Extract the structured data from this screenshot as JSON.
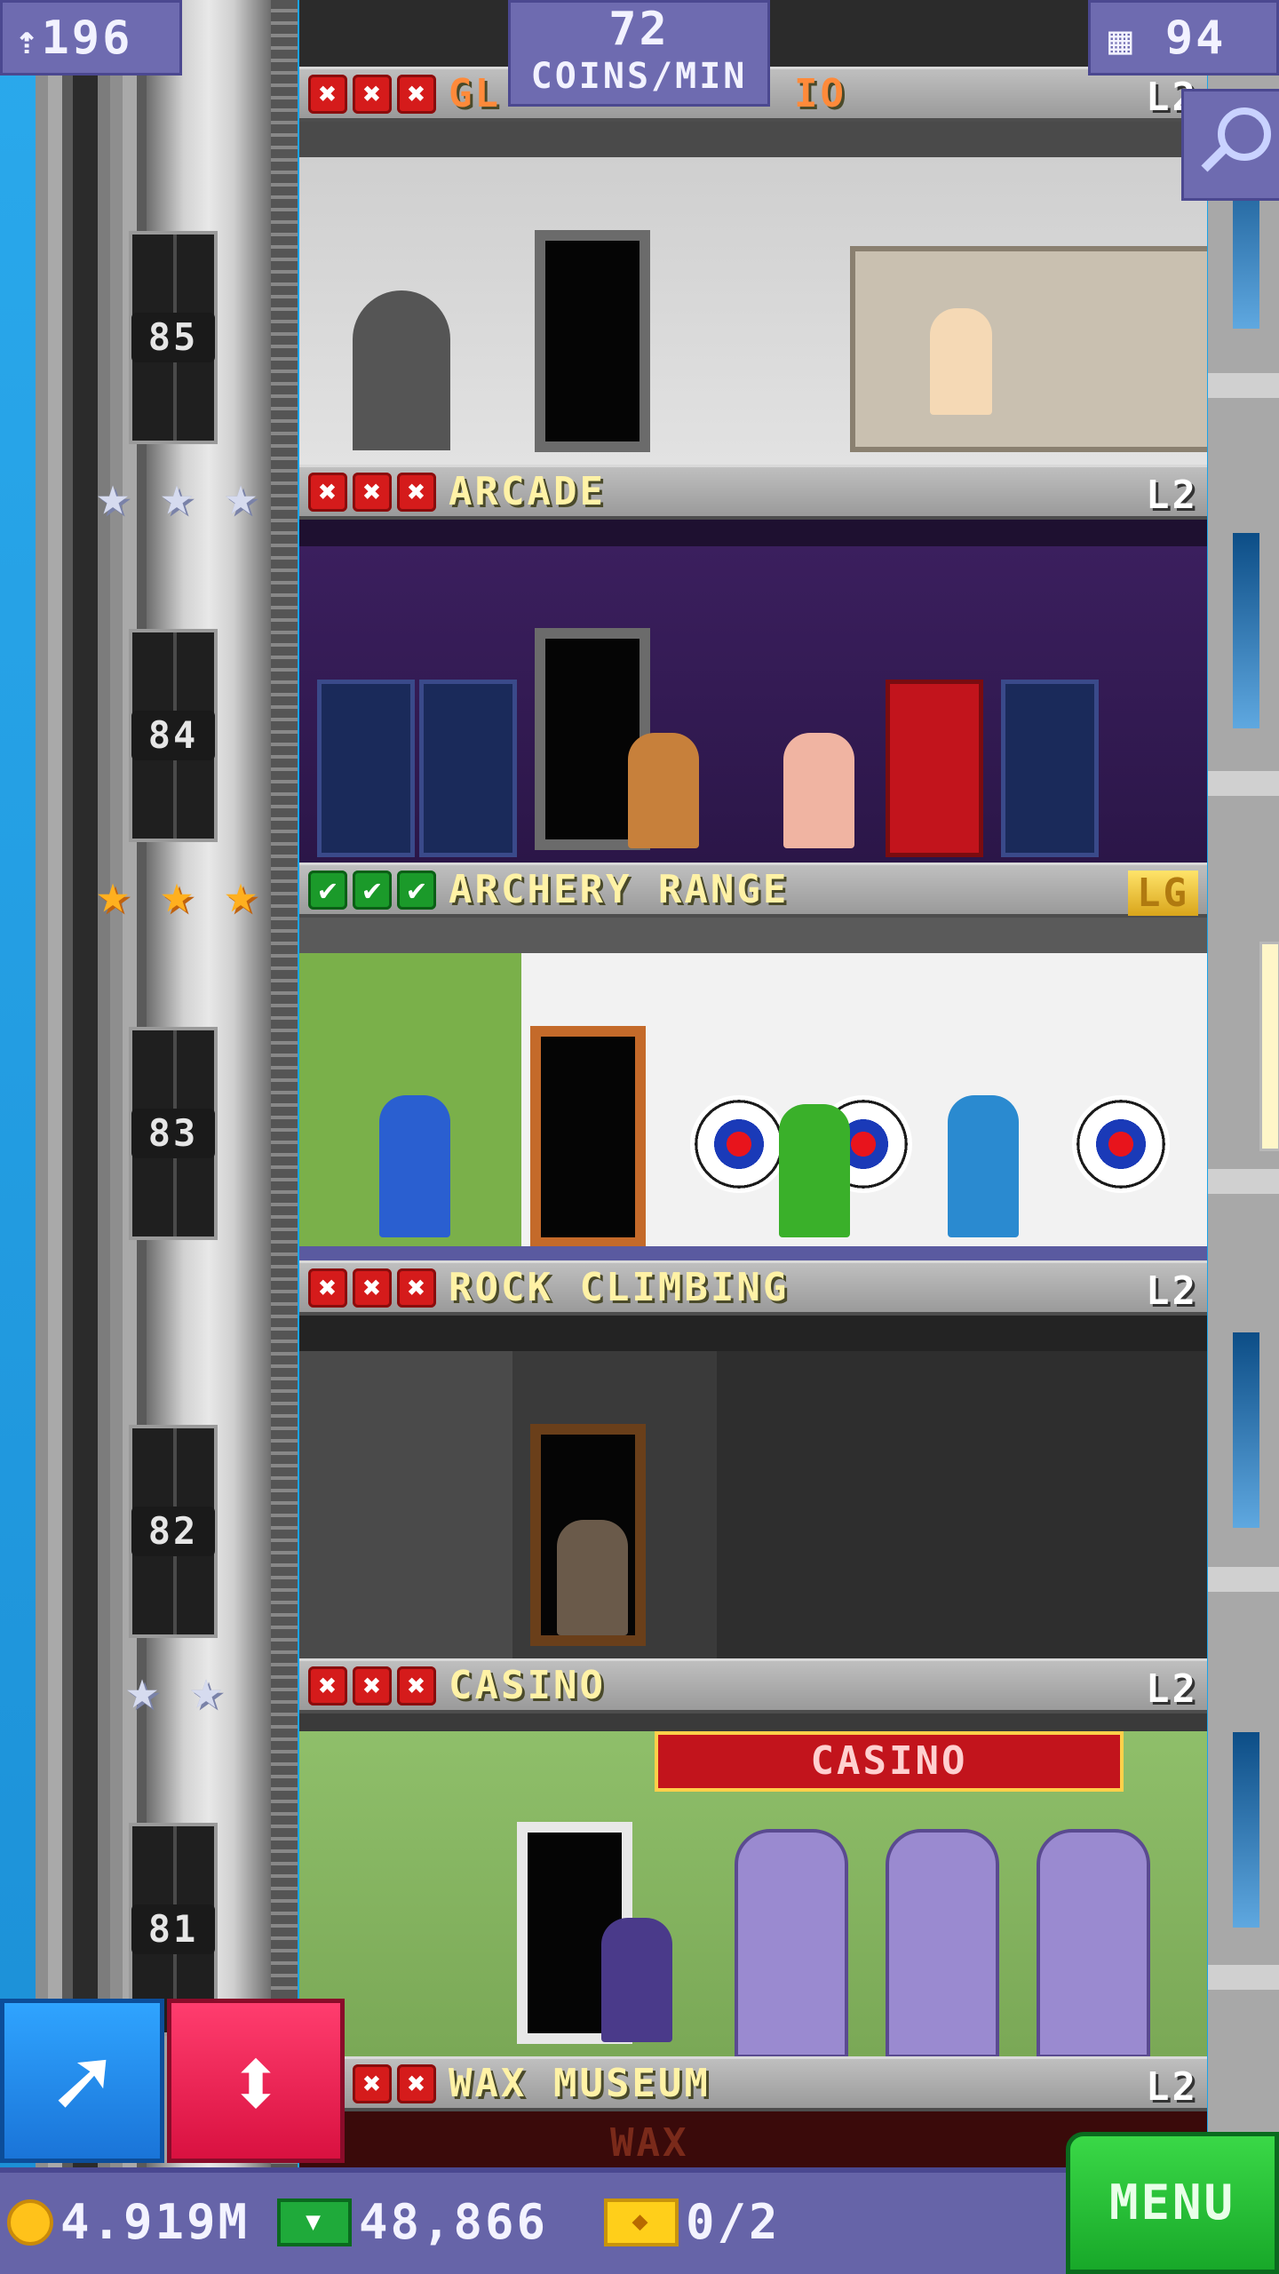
{
  "hud": {
    "population": "196",
    "rate_value": "72",
    "rate_unit": "COINS/MIN",
    "floors_count": "94"
  },
  "floors": [
    {
      "id": "glass",
      "name": "GL",
      "name_tail": "IO",
      "level": "L2",
      "marks": [
        "x",
        "x",
        "x"
      ],
      "number": "85",
      "stars": 3,
      "star_type": "silver"
    },
    {
      "id": "arcade",
      "name": "ARCADE",
      "level": "L2",
      "marks": [
        "x",
        "x",
        "x"
      ],
      "number": "84",
      "stars": 3,
      "star_type": "gold"
    },
    {
      "id": "archery",
      "name": "ARCHERY RANGE",
      "level": "LG",
      "marks": [
        "c",
        "c",
        "c"
      ],
      "number": "83",
      "stars": 0,
      "star_type": ""
    },
    {
      "id": "rock",
      "name": "ROCK CLIMBING",
      "level": "L2",
      "marks": [
        "x",
        "x",
        "x"
      ],
      "number": "82",
      "stars": 2,
      "star_type": "silver"
    },
    {
      "id": "casino",
      "name": "CASINO",
      "level": "L2",
      "marks": [
        "x",
        "x",
        "x"
      ],
      "number": "81",
      "stars": 0,
      "star_type": "",
      "sign": "CASINO"
    },
    {
      "id": "wax",
      "name": "WAX MUSEUM",
      "level": "L2",
      "marks": [
        "x",
        "x"
      ],
      "sign": "WAX"
    }
  ],
  "bottom": {
    "coins": "4.919M",
    "bux": "48,866",
    "tickets": "0/2",
    "menu_label": "MENU"
  },
  "icons": {
    "population": "person-up-icon",
    "floors": "building-icon",
    "zoom": "magnifier-icon",
    "build": "arrow-up-right-icon",
    "elevator": "up-down-arrows-icon"
  }
}
